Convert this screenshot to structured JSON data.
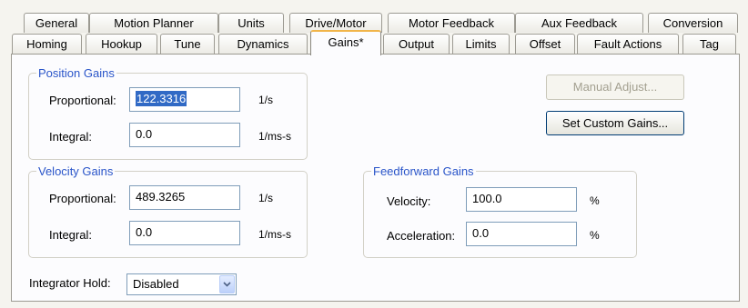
{
  "tabs_row1": [
    {
      "label": "General"
    },
    {
      "label": "Motion Planner"
    },
    {
      "label": "Units"
    },
    {
      "label": "Drive/Motor"
    },
    {
      "label": "Motor Feedback"
    },
    {
      "label": "Aux Feedback"
    },
    {
      "label": "Conversion"
    }
  ],
  "tabs_row2": [
    {
      "label": "Homing"
    },
    {
      "label": "Hookup"
    },
    {
      "label": "Tune"
    },
    {
      "label": "Dynamics"
    },
    {
      "label": "Gains*"
    },
    {
      "label": "Output"
    },
    {
      "label": "Limits"
    },
    {
      "label": "Offset"
    },
    {
      "label": "Fault Actions"
    },
    {
      "label": "Tag"
    }
  ],
  "active_tab": "Gains*",
  "position_gains": {
    "title": "Position Gains",
    "proportional_label": "Proportional:",
    "proportional_value": "122.3316",
    "proportional_unit": "1/s",
    "integral_label": "Integral:",
    "integral_value": "0.0",
    "integral_unit": "1/ms-s"
  },
  "velocity_gains": {
    "title": "Velocity Gains",
    "proportional_label": "Proportional:",
    "proportional_value": "489.3265",
    "proportional_unit": "1/s",
    "integral_label": "Integral:",
    "integral_value": "0.0",
    "integral_unit": "1/ms-s"
  },
  "feedforward_gains": {
    "title": "Feedforward Gains",
    "velocity_label": "Velocity:",
    "velocity_value": "100.0",
    "velocity_unit": "%",
    "acceleration_label": "Acceleration:",
    "acceleration_value": "0.0",
    "acceleration_unit": "%"
  },
  "buttons": {
    "manual_adjust": "Manual Adjust...",
    "set_custom_gains": "Set Custom Gains..."
  },
  "integrator_hold": {
    "label": "Integrator Hold:",
    "value": "Disabled"
  },
  "colors": {
    "group_title": "#2a55c9",
    "active_tab_accent": "#f1b54a",
    "selection": "#316ac5"
  },
  "icons": {
    "combo_arrow": "chevron-down-icon"
  }
}
